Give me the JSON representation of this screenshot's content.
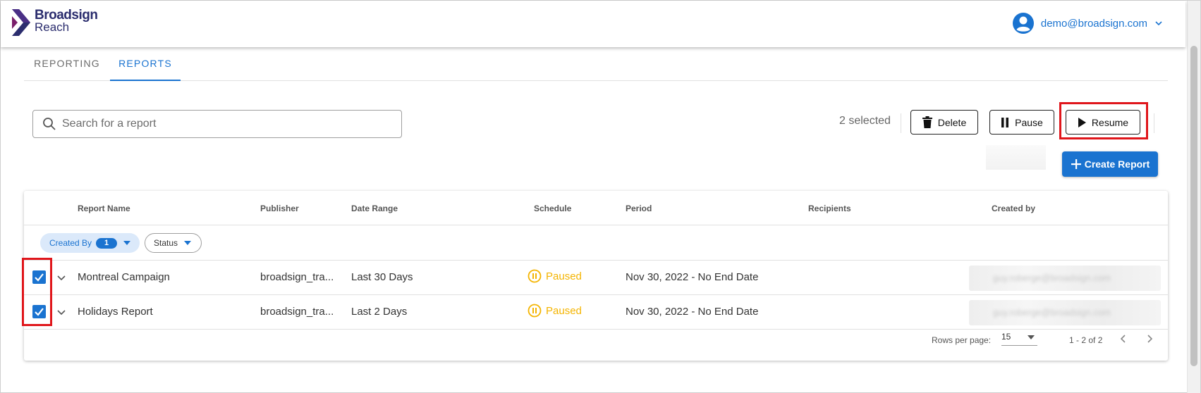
{
  "brand": {
    "line1": "Broadsign",
    "line2": "Reach",
    "color_primary": "#2b2d6e",
    "color_accent": "#7a1f6a"
  },
  "user": {
    "email": "demo@broadsign.com",
    "icon": "account-circle-icon"
  },
  "tabs": [
    {
      "label": "REPORTING",
      "active": false
    },
    {
      "label": "REPORTS",
      "active": true
    }
  ],
  "search": {
    "placeholder": "Search for a report",
    "value": ""
  },
  "toolbar": {
    "selected_text": "2 selected",
    "delete_label": "Delete",
    "pause_label": "Pause",
    "resume_label": "Resume",
    "create_label": "Create Report"
  },
  "table": {
    "columns": [
      "Report Name",
      "Publisher",
      "Date Range",
      "Schedule",
      "Period",
      "Recipients",
      "Created by"
    ],
    "filters": {
      "created_by_label": "Created By",
      "created_by_count": "1",
      "status_label": "Status"
    },
    "rows": [
      {
        "checked": true,
        "name": "Montreal Campaign",
        "publisher": "broadsign_tra...",
        "date_range": "Last 30 Days",
        "schedule": "Paused",
        "period": "Nov 30, 2022 - No End Date",
        "recipients": "",
        "created_by": "guy.roberge@broadsign.com"
      },
      {
        "checked": true,
        "name": "Holidays Report",
        "publisher": "broadsign_tra...",
        "date_range": "Last 2 Days",
        "schedule": "Paused",
        "period": "Nov 30, 2022 - No End Date",
        "recipients": "",
        "created_by": "guy.roberge@broadsign.com"
      }
    ],
    "footer": {
      "rows_per_page_label": "Rows per page:",
      "rows_per_page_value": "15",
      "range_text": "1 - 2 of 2"
    }
  },
  "colors": {
    "accent": "#1a73d0",
    "paused": "#f4b400",
    "highlight": "#e0161b"
  }
}
